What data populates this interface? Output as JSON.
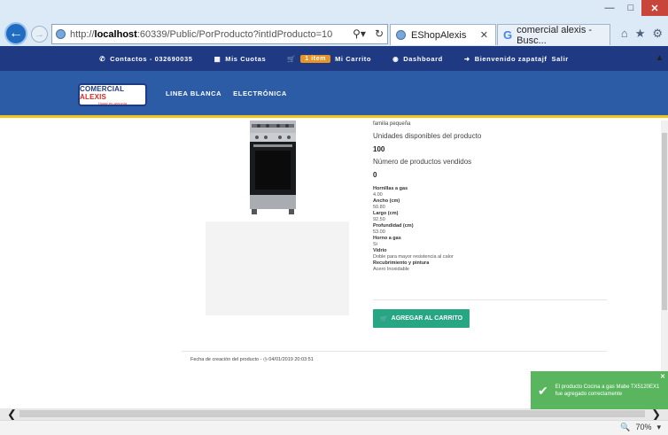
{
  "browser": {
    "address": {
      "prefix": "http://",
      "host": "localhost",
      "rest": ":60339/Public/PorProducto?intIdProducto=10"
    },
    "tabs": [
      {
        "label": "EShopAlexis"
      },
      {
        "label": "comercial alexis - Busc..."
      }
    ],
    "zoom": "70%"
  },
  "topbar": {
    "contact": "Contactos - 032690035",
    "accounts": "Mis Cuotas",
    "cart_count": "1 item",
    "cart": "Mi Carrito",
    "dashboard": "Dashboard",
    "welcome": "Bienvenido zapatajf",
    "logout": "Salir"
  },
  "nav": {
    "logo_main_a": "C",
    "logo_main_b": "OMERCIAL ",
    "logo_main_c": "ALEXIS",
    "logo_sub": "Hogar en armonía",
    "menu": [
      "LINEA BLANCA",
      "ELECTRÓNICA"
    ]
  },
  "product": {
    "desc_tail": "familia pequeña",
    "units_label": "Unidades disponibles del producto",
    "units_value": "100",
    "sold_label": "Número de productos vendidos",
    "sold_value": "0",
    "specs": [
      {
        "name": "Hornillas a gas",
        "value": "4.00"
      },
      {
        "name": "Ancho (cm)",
        "value": "50.80"
      },
      {
        "name": "Largo (cm)",
        "value": "92.50"
      },
      {
        "name": "Profundidad (cm)",
        "value": "53.00"
      },
      {
        "name": "Horno a gas",
        "value": "Si"
      },
      {
        "name": "Vidrio",
        "value": "Doble para mayor resistencia al calor"
      },
      {
        "name": "Recubrimiento y pintura",
        "value": "Acero Inoxidable"
      }
    ],
    "add_to_cart": "AGREGAR AL CARRITO",
    "created_label": "Fecha de creación del producto -",
    "created_value": "04/01/2019 20:03:51"
  },
  "toast": {
    "message": "El producto Cocina a gas Mabe TX5120EX1 fue agregado correctamente"
  },
  "colors": {
    "topbar": "#1f3a82",
    "navbar": "#2c5ca6",
    "accent": "#f0c419",
    "cart_button": "#26a682",
    "toast": "#5ab65e"
  }
}
